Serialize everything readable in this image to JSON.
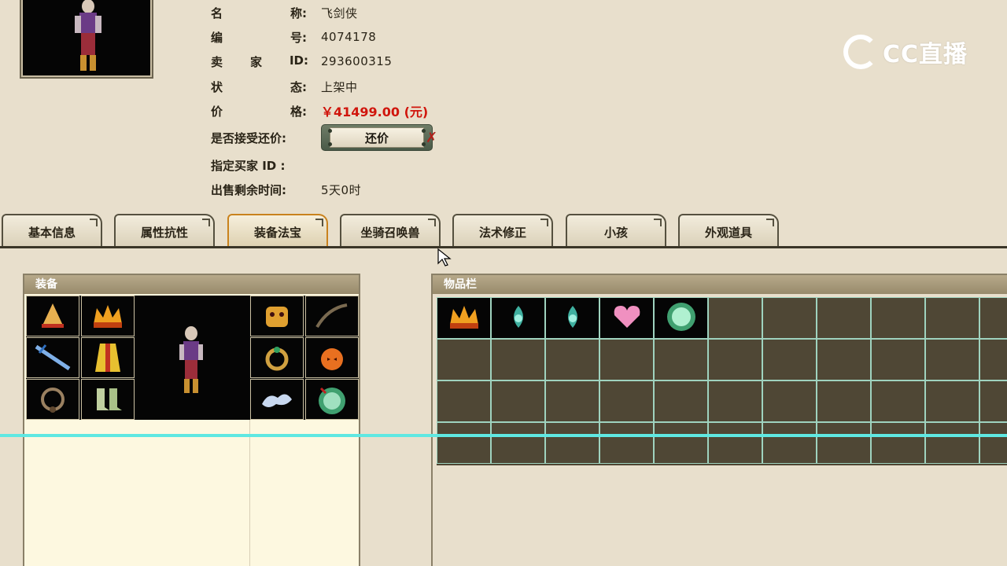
{
  "info": {
    "name_label": [
      "名",
      "称:"
    ],
    "name_value": "飞剑侠",
    "id_label": [
      "编",
      "号:"
    ],
    "id_value": "4074178",
    "seller_label": [
      "卖",
      "家",
      "ID:"
    ],
    "seller_value": "293600315",
    "status_label": [
      "状",
      "态:"
    ],
    "status_value": "上架中",
    "price_label": [
      "价",
      "格:"
    ],
    "price_value": "￥41499.00 (元)",
    "counter_label": "是否接受还价:",
    "counter_button": "还价",
    "buyer_label": "指定买家 ID :",
    "time_label": "出售剩余时间:",
    "time_value": "5天0时"
  },
  "logo": {
    "text": "CC直播"
  },
  "tabs": [
    {
      "label": "基本信息",
      "active": false
    },
    {
      "label": "属性抗性",
      "active": false
    },
    {
      "label": "装备法宝",
      "active": true
    },
    {
      "label": "坐骑召唤兽",
      "active": false
    },
    {
      "label": "法术修正",
      "active": false
    },
    {
      "label": "小孩",
      "active": false
    },
    {
      "label": "外观道具",
      "active": false
    }
  ],
  "equipment_panel": {
    "title": "装备",
    "left_slots": [
      "hat-icon",
      "crown-icon",
      "sword-icon",
      "robe-icon",
      "necklace-icon",
      "boots-icon"
    ],
    "right_slots": [
      "mask-icon",
      "whip-icon",
      "ring-icon",
      "pumpkin-icon",
      "cloud-icon",
      "orb-icon"
    ]
  },
  "inventory_panel": {
    "title": "物品栏",
    "items": [
      "crown-icon",
      "teal-gem-icon",
      "teal-gem-icon",
      "pink-heart-icon",
      "green-orb-icon"
    ]
  },
  "colors": {
    "price": "#d0150c",
    "accent": "#c9821d",
    "cyan_line": "#5fe8e2"
  }
}
